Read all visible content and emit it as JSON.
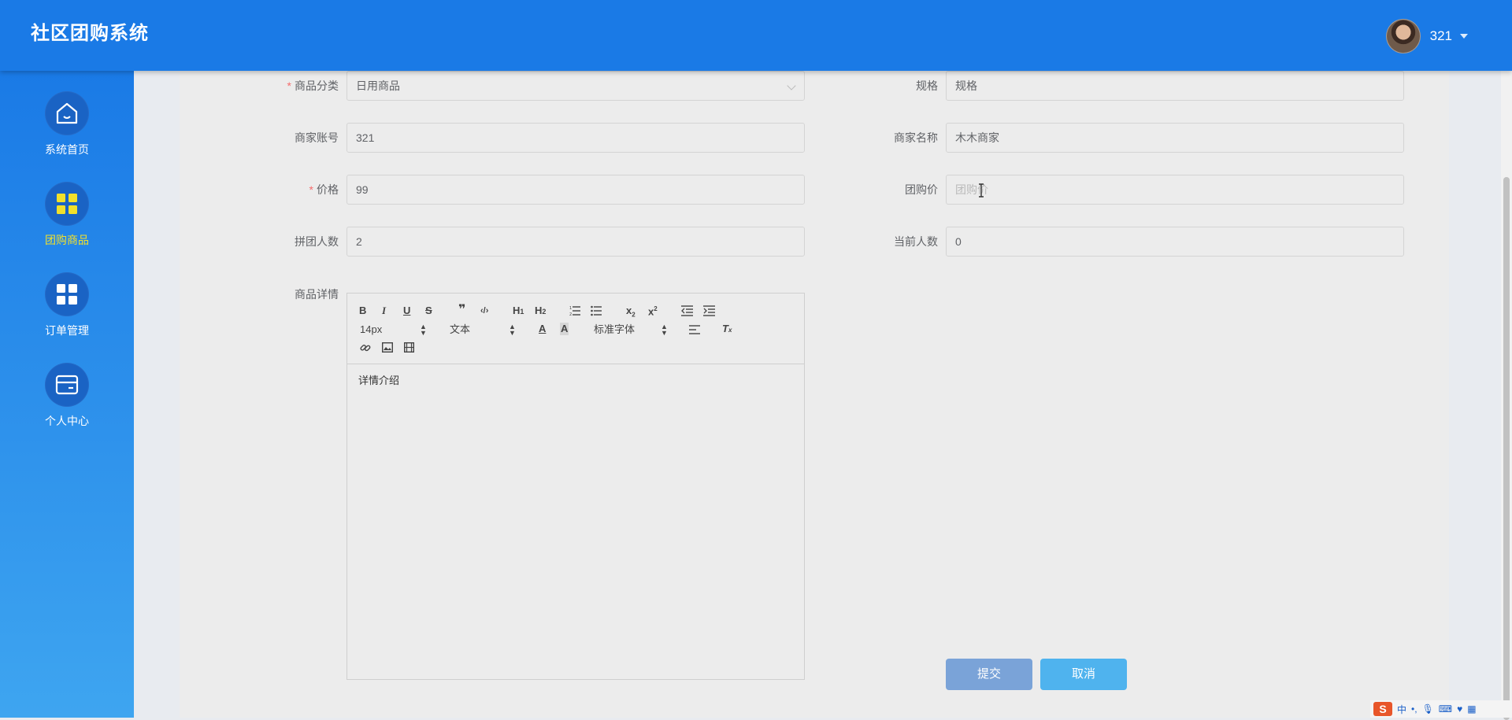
{
  "app": {
    "title": "社区团购系统"
  },
  "user": {
    "name": "321"
  },
  "sidebar": {
    "items": [
      {
        "label": "系统首页",
        "icon": "home-icon",
        "active": false
      },
      {
        "label": "团购商品",
        "icon": "grid-icon",
        "active": true
      },
      {
        "label": "订单管理",
        "icon": "grid-icon",
        "active": false
      },
      {
        "label": "个人中心",
        "icon": "wallet-icon",
        "active": false
      }
    ]
  },
  "form": {
    "category": {
      "label": "商品分类",
      "value": "日用商品"
    },
    "spec": {
      "label": "规格",
      "value": "规格"
    },
    "merchant_account": {
      "label": "商家账号",
      "value": "321"
    },
    "merchant_name": {
      "label": "商家名称",
      "value": "木木商家"
    },
    "price": {
      "label": "价格",
      "value": "99"
    },
    "group_price": {
      "label": "团购价",
      "placeholder": "团购价"
    },
    "group_size": {
      "label": "拼团人数",
      "value": "2"
    },
    "current_count": {
      "label": "当前人数",
      "value": "0"
    },
    "detail": {
      "label": "商品详情",
      "content": "详情介绍"
    }
  },
  "editor": {
    "font_size": "14px",
    "block_format": "文本",
    "font_family": "标准字体"
  },
  "buttons": {
    "submit": "提交",
    "cancel": "取消"
  },
  "ime": {
    "lang": "中"
  },
  "colors": {
    "primary": "#1a7ae6",
    "active_nav": "#f1e02b",
    "required": "#f56c6c"
  }
}
